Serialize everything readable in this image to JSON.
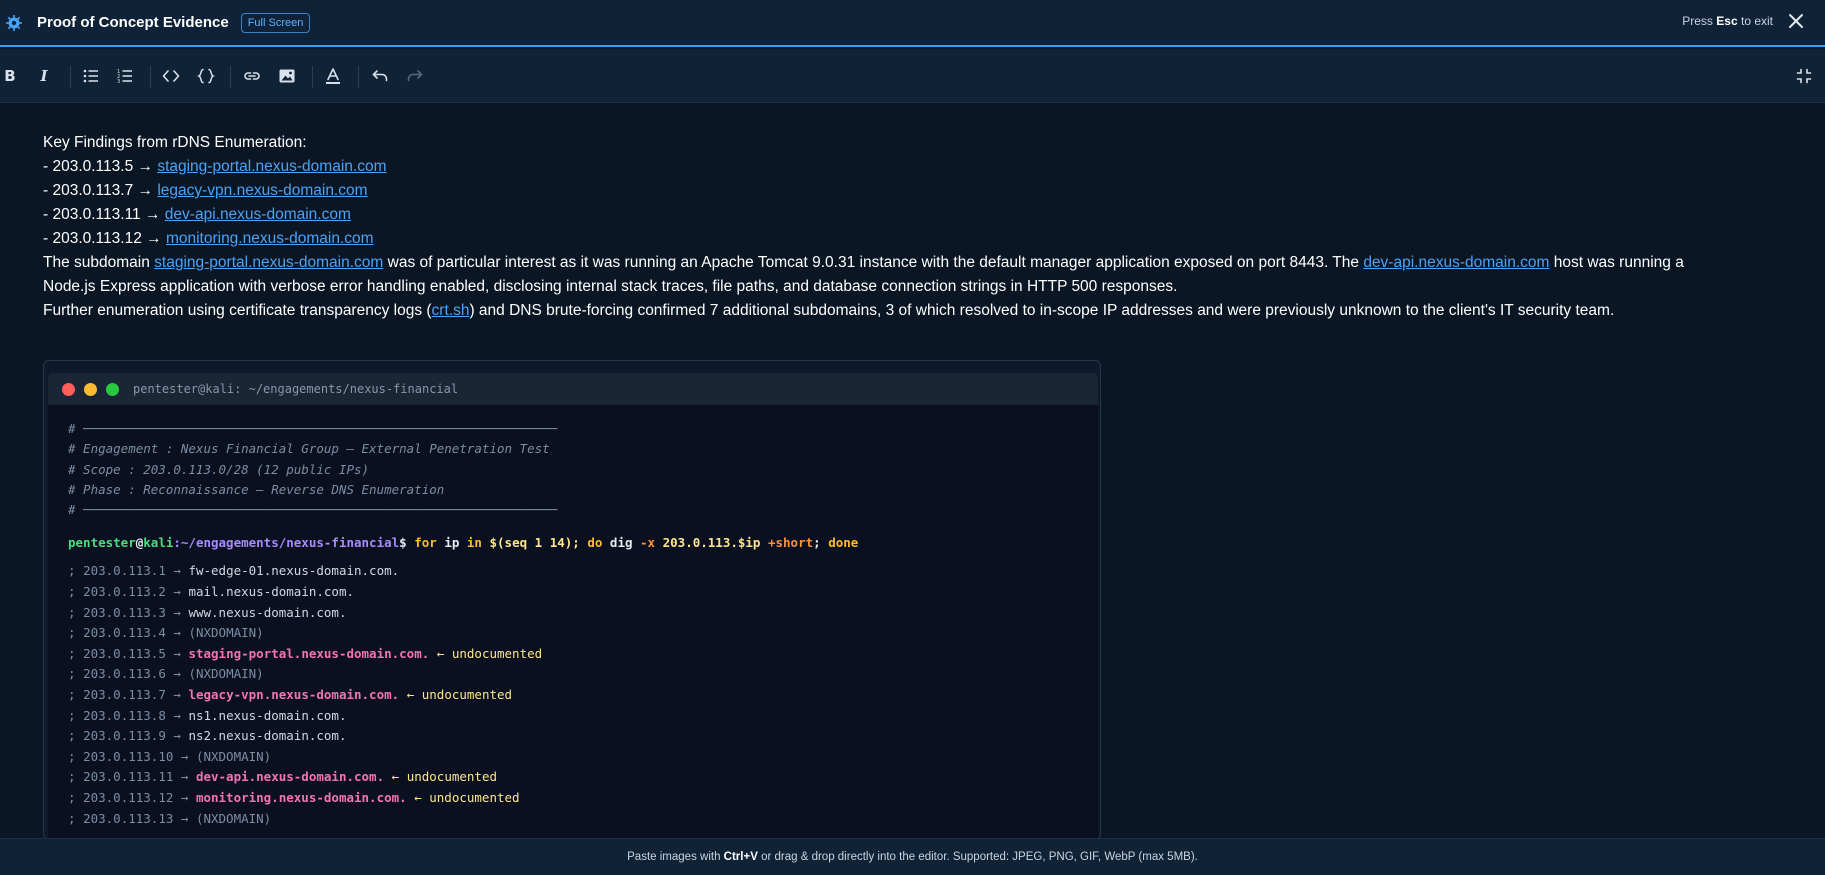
{
  "header": {
    "title": "Proof of Concept Evidence",
    "fullscreen_badge": "Full Screen",
    "esc_pre": "Press",
    "esc_key": "Esc",
    "esc_post": "to exit"
  },
  "toolbar": {
    "bold": "B",
    "italic": "I",
    "buttons": [
      "bold",
      "italic",
      "bullet-list",
      "numbered-list",
      "inline-code",
      "code-block",
      "link",
      "image",
      "text-color",
      "undo",
      "redo",
      "exit-fullscreen"
    ]
  },
  "content": {
    "heading": "Key Findings from rDNS Enumeration:",
    "findings": [
      {
        "prefix": "- 203.0.113.5 → ",
        "link": "staging-portal.nexus-domain.com"
      },
      {
        "prefix": "- 203.0.113.7 → ",
        "link": "legacy-vpn.nexus-domain.com"
      },
      {
        "prefix": "- 203.0.113.11 → ",
        "link": "dev-api.nexus-domain.com"
      },
      {
        "prefix": "- 203.0.113.12 → ",
        "link": "monitoring.nexus-domain.com"
      }
    ],
    "para1_a": "The subdomain ",
    "para1_link1": "staging-portal.nexus-domain.com",
    "para1_b": " was of particular interest as it was running an Apache Tomcat 9.0.31 instance with the default manager application exposed on port 8443. The ",
    "para1_link2": "dev-api.nexus-domain.com",
    "para1_c": " host was running a",
    "para1_d": "Node.js Express application with verbose error handling enabled, disclosing internal stack traces, file paths, and database connection strings in HTTP 500 responses.",
    "para2_a": "Further enumeration using certificate transparency logs (",
    "para2_link": "crt.sh",
    "para2_b": ") and DNS brute-forcing confirmed 7 additional subdomains, 3 of which resolved to in-scope IP addresses and were previously unknown to the client's IT security team."
  },
  "terminal": {
    "title": "pentester@kali: ~/engagements/nexus-financial",
    "comments": [
      "# ───────────────────────────────────────────────────────────────",
      "# Engagement : Nexus Financial Group – External Penetration Test",
      "# Scope : 203.0.113.0/28 (12 public IPs)",
      "# Phase : Reconnaissance – Reverse DNS Enumeration",
      "# ───────────────────────────────────────────────────────────────"
    ],
    "prompt": {
      "user": "pentester",
      "at": "@",
      "host": "kali",
      "path": ":~/engagements/nexus-financial",
      "dollar": "$ ",
      "cmd_for": "for",
      "cmd_ip": " ip ",
      "cmd_in": "in",
      "cmd_seq": " $(seq 1 14); ",
      "cmd_do": "do",
      "cmd_dig": " dig ",
      "cmd_x": "-x",
      "cmd_addr": " 203.0.113.$ip ",
      "cmd_short": "+short",
      "cmd_semi": "; ",
      "cmd_done": "done"
    },
    "output": [
      {
        "ip": "203.0.113.1",
        "host": "fw-edge-01.nexus-domain.com.",
        "kind": "normal",
        "note": ""
      },
      {
        "ip": "203.0.113.2",
        "host": "mail.nexus-domain.com.",
        "kind": "normal",
        "note": ""
      },
      {
        "ip": "203.0.113.3",
        "host": "www.nexus-domain.com.",
        "kind": "normal",
        "note": ""
      },
      {
        "ip": "203.0.113.4",
        "host": "(NXDOMAIN)",
        "kind": "nx",
        "note": ""
      },
      {
        "ip": "203.0.113.5",
        "host": "staging-portal.nexus-domain.com.",
        "kind": "hl",
        "note": "← undocumented"
      },
      {
        "ip": "203.0.113.6",
        "host": "(NXDOMAIN)",
        "kind": "nx",
        "note": ""
      },
      {
        "ip": "203.0.113.7",
        "host": "legacy-vpn.nexus-domain.com.",
        "kind": "hl",
        "note": "← undocumented"
      },
      {
        "ip": "203.0.113.8",
        "host": "ns1.nexus-domain.com.",
        "kind": "normal",
        "note": ""
      },
      {
        "ip": "203.0.113.9",
        "host": "ns2.nexus-domain.com.",
        "kind": "normal",
        "note": ""
      },
      {
        "ip": "203.0.113.10",
        "host": "(NXDOMAIN)",
        "kind": "nx",
        "note": ""
      },
      {
        "ip": "203.0.113.11",
        "host": "dev-api.nexus-domain.com.",
        "kind": "hl",
        "note": "← undocumented"
      },
      {
        "ip": "203.0.113.12",
        "host": "monitoring.nexus-domain.com.",
        "kind": "hl",
        "note": "← undocumented"
      },
      {
        "ip": "203.0.113.13",
        "host": "(NXDOMAIN)",
        "kind": "nx",
        "note": ""
      }
    ]
  },
  "footer": {
    "pre": "Paste images with ",
    "keys": "Ctrl+V",
    "post": " or drag & drop directly into the editor. Supported: JPEG, PNG, GIF, WebP (max 5MB)."
  },
  "colors": {
    "accent": "#3b9df0",
    "link": "#4aa3f5",
    "highlight": "#f472b6",
    "dot_red": "#ff5f57",
    "dot_yellow": "#febc2e",
    "dot_green": "#28c840"
  },
  "icons": [
    "bug-icon",
    "close-icon",
    "bold-icon",
    "italic-icon",
    "bullet-list-icon",
    "numbered-list-icon",
    "code-icon",
    "code-block-icon",
    "link-icon",
    "image-icon",
    "text-color-icon",
    "undo-icon",
    "redo-icon",
    "exit-fullscreen-icon"
  ]
}
